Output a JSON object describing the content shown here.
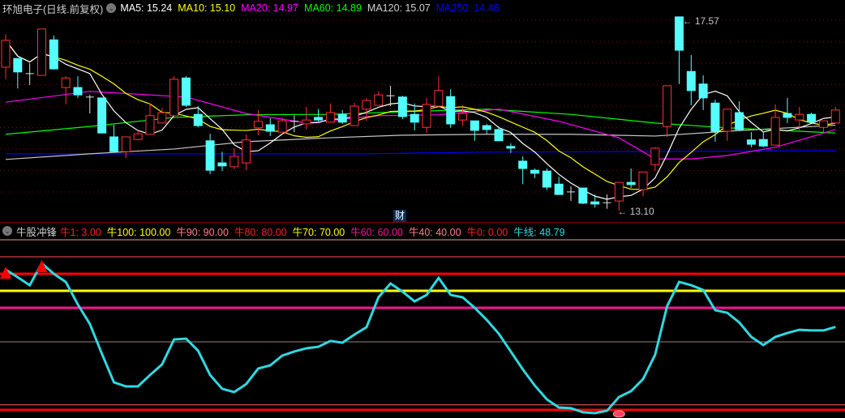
{
  "header": {
    "title": "环旭电子(日线.前复权)",
    "ma": [
      {
        "label": "MA5: 15.24",
        "color": "#ffffff"
      },
      {
        "label": "MA10: 15.10",
        "color": "#ffff00"
      },
      {
        "label": "MA20: 14.97",
        "color": "#ff00ff"
      },
      {
        "label": "MA60: 14.89",
        "color": "#00ff00"
      },
      {
        "label": "MA120: 15.07",
        "color": "#d0d0d0"
      },
      {
        "label": "MA250: 14.48",
        "color": "#0000ff"
      }
    ]
  },
  "indicator_header": {
    "title": "牛股冲锋",
    "items": [
      {
        "name": "牛1",
        "value": "3.00",
        "color": "#ff2020"
      },
      {
        "name": "牛100",
        "value": "100.00",
        "color": "#ffff00"
      },
      {
        "name": "牛90",
        "value": "90.00",
        "color": "#ff8080"
      },
      {
        "name": "牛80",
        "value": "80.00",
        "color": "#ff2020"
      },
      {
        "name": "牛70",
        "value": "70.00",
        "color": "#ffff00"
      },
      {
        "name": "牛60",
        "value": "60.00",
        "color": "#ff1493"
      },
      {
        "name": "牛40",
        "value": "40.00",
        "color": "#ff8080"
      },
      {
        "name": "牛0",
        "value": "0.00",
        "color": "#ff2020"
      },
      {
        "name": "牛线",
        "value": "48.79",
        "color": "#30d8e0"
      }
    ]
  },
  "labels": {
    "cai": "财",
    "high": "17.57",
    "low": "13.10"
  },
  "chart_data": [
    {
      "type": "candlestick",
      "title": "环旭电子(日线.前复权)",
      "ylim": [
        13.0,
        17.7
      ],
      "candles": [
        [
          16.41,
          17.17,
          16.13,
          17.03
        ],
        [
          16.61,
          16.61,
          15.92,
          16.3
        ],
        [
          16.26,
          16.5,
          16.0,
          16.26
        ],
        [
          16.22,
          17.29,
          16.22,
          17.29
        ],
        [
          17.04,
          17.14,
          16.35,
          16.37
        ],
        [
          15.94,
          16.2,
          15.55,
          16.16
        ],
        [
          15.94,
          16.2,
          15.7,
          15.77
        ],
        [
          15.72,
          15.77,
          15.34,
          15.72
        ],
        [
          15.7,
          15.7,
          14.89,
          14.89
        ],
        [
          14.8,
          15.08,
          14.44,
          14.46
        ],
        [
          14.46,
          14.8,
          14.31,
          14.8
        ],
        [
          14.74,
          14.97,
          14.72,
          14.87
        ],
        [
          14.86,
          15.57,
          14.86,
          15.29
        ],
        [
          15.12,
          15.47,
          15.12,
          15.36
        ],
        [
          15.29,
          16.2,
          15.29,
          16.13
        ],
        [
          16.16,
          16.2,
          15.49,
          15.53
        ],
        [
          15.32,
          15.51,
          15.02,
          15.06
        ],
        [
          14.71,
          14.87,
          13.94,
          14.03
        ],
        [
          14.2,
          14.46,
          14.01,
          14.13
        ],
        [
          14.11,
          14.54,
          14.05,
          14.35
        ],
        [
          14.2,
          14.86,
          14.03,
          14.73
        ],
        [
          15.01,
          15.42,
          14.84,
          15.16
        ],
        [
          15.08,
          15.23,
          14.82,
          14.93
        ],
        [
          14.91,
          15.25,
          14.91,
          15.17
        ],
        [
          15.16,
          15.3,
          14.91,
          15.16
        ],
        [
          15.1,
          15.49,
          14.97,
          15.19
        ],
        [
          15.25,
          15.44,
          15.16,
          15.19
        ],
        [
          15.14,
          15.57,
          15.14,
          15.36
        ],
        [
          15.32,
          15.42,
          15.1,
          15.14
        ],
        [
          15.06,
          15.59,
          15.06,
          15.51
        ],
        [
          15.44,
          15.7,
          15.17,
          15.64
        ],
        [
          15.53,
          15.85,
          15.53,
          15.77
        ],
        [
          15.75,
          15.98,
          15.51,
          15.75
        ],
        [
          15.72,
          15.75,
          15.21,
          15.27
        ],
        [
          15.32,
          15.57,
          14.95,
          15.14
        ],
        [
          15.02,
          15.7,
          14.89,
          15.55
        ],
        [
          15.51,
          16.2,
          15.51,
          15.87
        ],
        [
          15.73,
          15.9,
          15.01,
          15.1
        ],
        [
          15.19,
          15.47,
          15.06,
          15.34
        ],
        [
          15.17,
          15.17,
          14.71,
          14.95
        ],
        [
          15.06,
          15.1,
          14.87,
          14.97
        ],
        [
          14.97,
          15.04,
          14.71,
          14.71
        ],
        [
          14.58,
          14.65,
          14.43,
          14.54
        ],
        [
          14.24,
          14.35,
          13.71,
          14.07
        ],
        [
          14.03,
          14.07,
          13.85,
          13.96
        ],
        [
          14.01,
          14.07,
          13.57,
          13.64
        ],
        [
          13.71,
          13.88,
          13.47,
          13.47
        ],
        [
          13.53,
          13.66,
          13.32,
          13.53
        ],
        [
          13.62,
          13.62,
          13.25,
          13.27
        ],
        [
          13.3,
          13.47,
          13.17,
          13.25
        ],
        [
          13.28,
          13.47,
          13.14,
          13.28
        ],
        [
          13.32,
          13.75,
          13.1,
          13.75
        ],
        [
          13.75,
          14.07,
          13.62,
          13.7
        ],
        [
          13.58,
          13.99,
          13.43,
          13.99
        ],
        [
          14.16,
          14.56,
          14.01,
          14.54
        ],
        [
          15.04,
          15.98,
          14.8,
          15.98
        ],
        [
          17.57,
          17.57,
          16.02,
          16.8
        ],
        [
          16.31,
          16.69,
          15.53,
          15.87
        ],
        [
          16.02,
          16.22,
          15.42,
          15.7
        ],
        [
          15.58,
          15.66,
          14.69,
          14.93
        ],
        [
          14.93,
          15.44,
          14.71,
          15.44
        ],
        [
          15.36,
          15.62,
          14.95,
          14.97
        ],
        [
          14.73,
          14.91,
          14.56,
          14.63
        ],
        [
          14.74,
          14.93,
          14.56,
          14.59
        ],
        [
          14.61,
          15.55,
          14.61,
          15.25
        ],
        [
          15.34,
          15.7,
          15.12,
          15.25
        ],
        [
          15.19,
          15.49,
          14.95,
          15.32
        ],
        [
          15.32,
          15.36,
          15.14,
          15.14
        ],
        [
          15.02,
          15.17,
          14.89,
          15.17
        ],
        [
          15.12,
          15.49,
          15.12,
          15.42
        ]
      ],
      "ma_series": [
        {
          "name": "MA20",
          "color": "#ff00ff",
          "points": [
            [
              0,
              15.6
            ],
            [
              7,
              15.85
            ],
            [
              15,
              15.72
            ],
            [
              20,
              15.34
            ],
            [
              25,
              15.12
            ],
            [
              31,
              15.29
            ],
            [
              36,
              15.31
            ],
            [
              41,
              15.44
            ],
            [
              46,
              15.16
            ],
            [
              51,
              14.78
            ],
            [
              54,
              14.29
            ],
            [
              57,
              14.29
            ],
            [
              60,
              14.37
            ],
            [
              64,
              14.56
            ],
            [
              69,
              14.97
            ]
          ]
        },
        {
          "name": "MA60",
          "color": "#00ff00",
          "points": [
            [
              0,
              14.86
            ],
            [
              7,
              15.04
            ],
            [
              14,
              15.25
            ],
            [
              20,
              15.31
            ],
            [
              27,
              15.32
            ],
            [
              33,
              15.38
            ],
            [
              40,
              15.44
            ],
            [
              47,
              15.32
            ],
            [
              54,
              15.12
            ],
            [
              60,
              15.01
            ],
            [
              69,
              14.89
            ]
          ]
        },
        {
          "name": "MA120",
          "color": "#c8c8c8",
          "points": [
            [
              0,
              14.28
            ],
            [
              7,
              14.41
            ],
            [
              14,
              14.52
            ],
            [
              20,
              14.69
            ],
            [
              27,
              14.78
            ],
            [
              33,
              14.84
            ],
            [
              40,
              14.86
            ],
            [
              47,
              14.86
            ],
            [
              54,
              14.82
            ],
            [
              60,
              14.93
            ],
            [
              69,
              15.07
            ]
          ]
        },
        {
          "name": "MA250",
          "color": "#0000ff",
          "points": [
            [
              0,
              14.41
            ],
            [
              30,
              14.41
            ],
            [
              40,
              14.45
            ],
            [
              69,
              14.48
            ]
          ]
        }
      ],
      "annotations": [
        {
          "index": 56,
          "price": 17.57,
          "text": "17.57"
        },
        {
          "index": 51,
          "price": 13.1,
          "text": "13.10"
        }
      ]
    },
    {
      "type": "line",
      "title": "牛股冲锋",
      "ylim": [
        0,
        100
      ],
      "levels": [
        {
          "name": "牛100",
          "value": 100,
          "color": "#ff9090",
          "weight": "thin"
        },
        {
          "name": "牛90",
          "value": 90,
          "color": "#ff5050",
          "weight": "thin"
        },
        {
          "name": "牛80",
          "value": 80,
          "color": "#ff0000",
          "weight": "thick"
        },
        {
          "name": "牛70",
          "value": 70,
          "color": "#ffff00",
          "weight": "thick"
        },
        {
          "name": "牛60",
          "value": 60,
          "color": "#ff1493",
          "weight": "thick"
        },
        {
          "name": "牛40",
          "value": 40,
          "color": "#a08080",
          "weight": "thin"
        },
        {
          "name": "牛1",
          "value": 3,
          "color": "#ff6060",
          "weight": "thin"
        },
        {
          "name": "牛0",
          "value": 0,
          "color": "#ff0000",
          "weight": "thick"
        }
      ],
      "series": [
        {
          "name": "牛线",
          "color": "#30d8e0",
          "values": [
            82.4,
            78,
            73.3,
            86.2,
            80,
            75.2,
            62,
            50.5,
            33,
            16.2,
            13.8,
            13.8,
            20.5,
            26.7,
            41.4,
            41.9,
            34.8,
            20.5,
            12.4,
            10.5,
            15.2,
            24.3,
            26.2,
            31.9,
            34.3,
            36.2,
            37.1,
            40.5,
            39.5,
            44.3,
            48.6,
            66.2,
            74.3,
            69.5,
            63.8,
            67.6,
            77.6,
            67.6,
            66.2,
            60.0,
            52.9,
            44.8,
            34.3,
            23.8,
            14.3,
            6.2,
            1.4,
            1.0,
            -1.4,
            -1.9,
            -0.5,
            7.6,
            11.0,
            18.1,
            32.4,
            61.0,
            75.2,
            73.3,
            70.5,
            58.6,
            57.1,
            51.4,
            42.9,
            38.1,
            42.9,
            45.2,
            47.1,
            46.7,
            46.7,
            48.79
          ]
        }
      ],
      "signals": [
        {
          "index": 0,
          "type": "buy-triangle"
        },
        {
          "index": 3,
          "type": "buy-triangle"
        },
        {
          "index": 51,
          "type": "bottom-marker"
        }
      ]
    }
  ]
}
